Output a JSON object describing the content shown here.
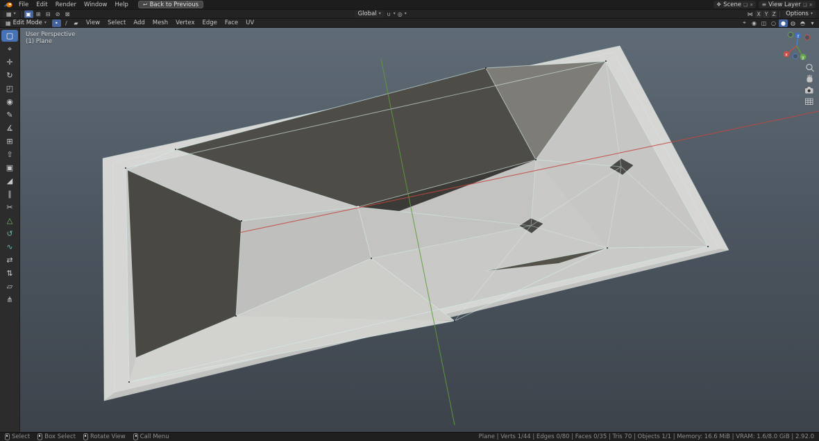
{
  "colors": {
    "accent_blue": "#4772b3",
    "header_bg": "#1d1d1d",
    "viewport_top": "#5f6b76",
    "viewport_bottom": "#3d434b",
    "mesh_light": "#d6d6d4",
    "mesh_dark": "#4b4945",
    "wireframe": "#d7efec",
    "axis_x_red": "#c2463e",
    "axis_y_green": "#5d9c3b"
  },
  "topbar": {
    "menus": [
      "File",
      "Edit",
      "Render",
      "Window",
      "Help"
    ],
    "back_button": "Back to Previous",
    "scene_label": "Scene",
    "view_layer_label": "View Layer"
  },
  "tool_settings": {
    "select_mode_icons": [
      {
        "name": "select-mode-set",
        "glyph": "▣",
        "active": true
      },
      {
        "name": "select-mode-extend",
        "glyph": "⊞"
      },
      {
        "name": "select-mode-subtract",
        "glyph": "⊟"
      },
      {
        "name": "select-mode-invert",
        "glyph": "⊘"
      },
      {
        "name": "select-mode-intersect",
        "glyph": "⊠"
      }
    ],
    "transform_orientation": "Global",
    "snap_glyph": "∪",
    "proportional_glyph": "◎",
    "mirror_glyph": "⋈",
    "mirror_axes": [
      "X",
      "Y",
      "Z"
    ],
    "options_label": "Options"
  },
  "viewport_header": {
    "mode": "Edit Mode",
    "mode_icon_glyph": "▦",
    "select_modes": [
      {
        "name": "vertex-select",
        "glyph": "•",
        "active": true
      },
      {
        "name": "edge-select",
        "glyph": "/"
      },
      {
        "name": "face-select",
        "glyph": "▰"
      }
    ],
    "menus": [
      "View",
      "Select",
      "Add",
      "Mesh",
      "Vertex",
      "Edge",
      "Face",
      "UV"
    ],
    "right_controls": [
      {
        "name": "gizmo-toggle",
        "glyph": "⌖"
      },
      {
        "name": "overlays-toggle",
        "glyph": "◉"
      },
      {
        "name": "xray-toggle",
        "glyph": "◫"
      },
      {
        "name": "shading-wireframe",
        "glyph": "○"
      },
      {
        "name": "shading-solid",
        "glyph": "●",
        "active": true
      },
      {
        "name": "shading-material",
        "glyph": "◍"
      },
      {
        "name": "shading-rendered",
        "glyph": "◓"
      },
      {
        "name": "shading-dropdown",
        "glyph": "▾"
      }
    ]
  },
  "toolbar": {
    "active_index": 0,
    "tools": [
      {
        "name": "select-box",
        "glyph": "▢"
      },
      {
        "name": "cursor",
        "glyph": "⌖"
      },
      {
        "name": "move",
        "glyph": "✛"
      },
      {
        "name": "rotate",
        "glyph": "↻"
      },
      {
        "name": "scale",
        "glyph": "◰"
      },
      {
        "name": "transform",
        "glyph": "◉"
      },
      {
        "name": "annotate",
        "glyph": "✎"
      },
      {
        "name": "measure",
        "glyph": "∡"
      },
      {
        "name": "add-cube",
        "glyph": "⊞"
      },
      {
        "name": "extrude-region",
        "glyph": "⇧"
      },
      {
        "name": "inset-faces",
        "glyph": "▣"
      },
      {
        "name": "bevel",
        "glyph": "◢"
      },
      {
        "name": "loop-cut",
        "glyph": "∥"
      },
      {
        "name": "knife",
        "glyph": "✂"
      },
      {
        "name": "poly-build",
        "glyph": "△",
        "color": "#7ec16c"
      },
      {
        "name": "spin",
        "glyph": "↺",
        "color": "#6ab6b0"
      },
      {
        "name": "smooth",
        "glyph": "∿",
        "color": "#6ab6b0"
      },
      {
        "name": "edge-slide",
        "glyph": "⇄"
      },
      {
        "name": "shrink-fatten",
        "glyph": "⇅"
      },
      {
        "name": "shear",
        "glyph": "▱"
      },
      {
        "name": "rip-region",
        "glyph": "⋔"
      }
    ]
  },
  "viewport": {
    "overlay_line1": "User Perspective",
    "overlay_line2": "(1) Plane"
  },
  "nav_gizmo": {
    "labels": [
      "x",
      "y",
      "z"
    ]
  },
  "statusbar": {
    "hints": [
      {
        "icon": "mouse-left",
        "label": "Select"
      },
      {
        "icon": "mouse-left-drag",
        "label": "Box Select"
      },
      {
        "icon": "mouse-middle",
        "label": "Rotate View"
      },
      {
        "icon": "mouse-right",
        "label": "Call Menu"
      }
    ],
    "stats": "Plane | Verts 1/44 | Edges 0/80 | Faces 0/35 | Tris 70 | Objects 1/1 | Memory: 16.6 MiB | VRAM: 1.6/8.0 GiB | 2.92.0"
  }
}
